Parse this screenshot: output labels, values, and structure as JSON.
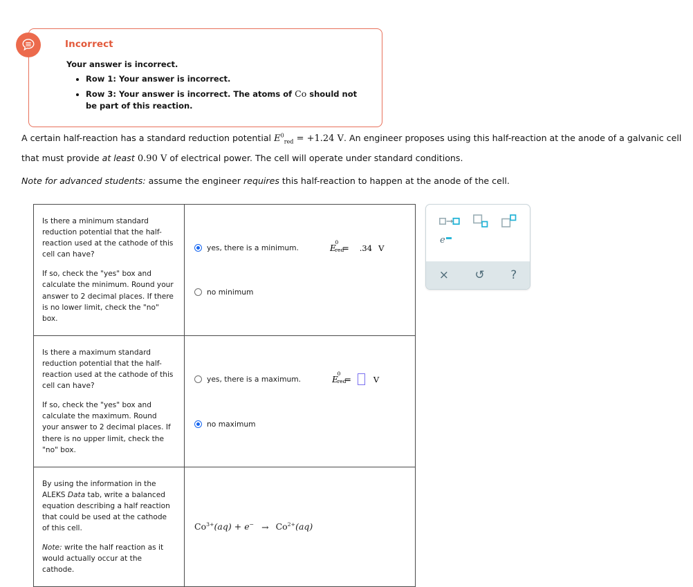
{
  "feedback": {
    "icon": "speech-bubble-icon",
    "title": "Incorrect",
    "lead": "Your answer is incorrect.",
    "accent_color": "#e2593b",
    "border_color": "#e8705a",
    "items": [
      {
        "text_before": "Row 1: Your answer is incorrect.",
        "symbol": "",
        "text_after": ""
      },
      {
        "text_before": "Row 3: Your answer is incorrect. The atoms of ",
        "symbol": "Co",
        "text_after": " should not be part of this reaction."
      }
    ]
  },
  "statement": {
    "p1_a": "A certain half-reaction has a standard reduction potential ",
    "p1_symbol_main": "E",
    "p1_symbol_sup": "0",
    "p1_symbol_sub": "red",
    "p1_b": " = +1.24 ",
    "p1_unit": "V",
    "p1_c": ". An engineer proposes using this half-reaction at the anode of a galvanic cell that must provide ",
    "p1_italic": "at least",
    "p1_d": " 0.90 ",
    "p1_unit2": "V",
    "p1_e": " of electrical power. The cell will operate under standard conditions.",
    "p2_italic": "Note for advanced students:",
    "p2_a": " assume the engineer ",
    "p2_italic2": "requires",
    "p2_b": " this half-reaction to happen at the anode of the cell."
  },
  "table": {
    "rows": [
      {
        "prompt_p1": "Is there a minimum standard reduction potential that the half-reaction used at the cathode of this cell can have?",
        "prompt_p2": "If so, check the \"yes\" box and calculate the minimum. Round your answer to 2 decimal places. If there is no lower limit, check the \"no\" box.",
        "option_yes_label": "yes, there is a minimum.",
        "option_no_label": "no minimum",
        "selected": "yes",
        "eq_symbol": "E",
        "eq_sup": "0",
        "eq_sub": "red",
        "eq_equals": "=",
        "value": ".34",
        "unit": "V",
        "has_input_box": false
      },
      {
        "prompt_p1": "Is there a maximum standard reduction potential that the half-reaction used at the cathode of this cell can have?",
        "prompt_p2": "If so, check the \"yes\" box and calculate the maximum. Round your answer to 2 decimal places. If there is no upper limit, check the \"no\" box.",
        "option_yes_label": "yes, there is a maximum.",
        "option_no_label": "no maximum",
        "selected": "no",
        "eq_symbol": "E",
        "eq_sup": "0",
        "eq_sub": "red",
        "eq_equals": "=",
        "value": "",
        "unit": "V",
        "has_input_box": true
      }
    ],
    "equation_row": {
      "prompt_p1_a": "By using the information in the ALEKS ",
      "prompt_p1_italic": "Data",
      "prompt_p1_b": " tab, write a balanced equation describing a half reaction that could be used at the cathode of this cell.",
      "prompt_p2_italic": "Note:",
      "prompt_p2_b": " write the half reaction as it would actually occur at the cathode.",
      "equation": {
        "lhs_species": "Co",
        "lhs_charge": "3+",
        "lhs_state": "(aq)",
        "plus": "+",
        "electron": "e",
        "electron_charge": "−",
        "arrow": "→",
        "rhs_species": "Co",
        "rhs_charge": "2+",
        "rhs_state": "(aq)"
      }
    }
  },
  "palette": {
    "buttons": [
      {
        "name": "convert-to-arrow-icon",
        "label": "□→□"
      },
      {
        "name": "subscript-box-icon",
        "label": "□□"
      },
      {
        "name": "superscript-box-icon",
        "label": "□□"
      }
    ],
    "electron_main": "e",
    "electron_sup": "−",
    "actions": [
      {
        "name": "clear-button",
        "glyph": "×"
      },
      {
        "name": "undo-button",
        "glyph": "↺"
      },
      {
        "name": "help-button",
        "glyph": "?"
      }
    ],
    "accent_color": "#29b6d8",
    "bar_color": "#dde6e9",
    "icon_color": "#4e6b78"
  }
}
